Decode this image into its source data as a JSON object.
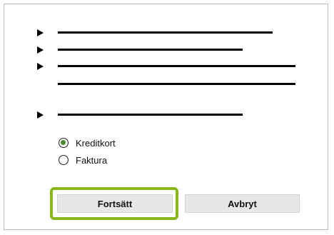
{
  "payment": {
    "options": [
      {
        "label": "Kreditkort",
        "selected": true
      },
      {
        "label": "Faktura",
        "selected": false
      }
    ]
  },
  "buttons": {
    "continue_label": "Fortsätt",
    "cancel_label": "Avbryt"
  },
  "colors": {
    "highlight_border": "#8ab81b",
    "radio_selected": "#4b8a2a",
    "button_background": "#e7e7e7"
  }
}
